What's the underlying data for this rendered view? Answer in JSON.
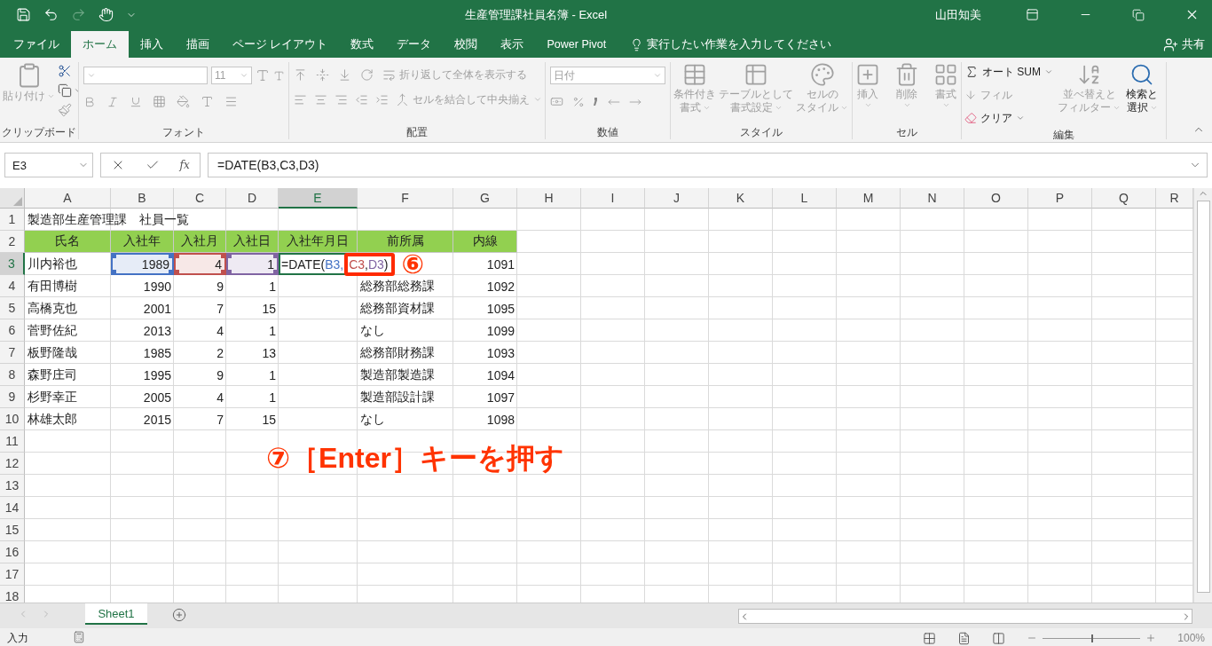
{
  "window": {
    "title": "生産管理課社員名簿  -  Excel",
    "user": "山田知美"
  },
  "tabs": [
    {
      "label": "ファイル",
      "selected": false
    },
    {
      "label": "ホーム",
      "selected": true
    },
    {
      "label": "挿入",
      "selected": false
    },
    {
      "label": "描画",
      "selected": false
    },
    {
      "label": "ページ レイアウト",
      "selected": false
    },
    {
      "label": "数式",
      "selected": false
    },
    {
      "label": "データ",
      "selected": false
    },
    {
      "label": "校閲",
      "selected": false
    },
    {
      "label": "表示",
      "selected": false
    },
    {
      "label": "Power Pivot",
      "selected": false
    }
  ],
  "tell_me": "実行したい作業を入力してください",
  "share": "共有",
  "ribbon": {
    "groups": [
      {
        "label": "クリップボード",
        "items": [
          {
            "lines": [
              "貼り付け"
            ],
            "disabled": true
          }
        ]
      },
      {
        "label": "フォント",
        "items": [
          {
            "value": "11",
            "disabled": true
          }
        ]
      },
      {
        "label": "配置",
        "items": [
          {
            "lines": [
              "折り返して全体を表示する"
            ],
            "disabled": true
          },
          {
            "lines": [
              "セルを結合して中央揃え"
            ],
            "disabled": true
          }
        ]
      },
      {
        "label": "数値",
        "items": [
          {
            "value": "日付",
            "disabled": true
          }
        ]
      },
      {
        "label": "スタイル",
        "items": [
          {
            "lines": [
              "条件付き",
              "書式"
            ],
            "disabled": true
          },
          {
            "lines": [
              "テーブルとして",
              "書式設定"
            ],
            "disabled": true
          },
          {
            "lines": [
              "セルの",
              "スタイル"
            ],
            "disabled": true
          }
        ]
      },
      {
        "label": "セル",
        "items": [
          {
            "lines": [
              "挿入"
            ],
            "disabled": true
          },
          {
            "lines": [
              "削除"
            ],
            "disabled": true
          },
          {
            "lines": [
              "書式"
            ],
            "disabled": true
          }
        ]
      },
      {
        "label": "編集",
        "items": [
          {
            "lines": [
              "オート SUM"
            ],
            "disabled": false
          },
          {
            "lines": [
              "フィル"
            ],
            "disabled": true
          },
          {
            "lines": [
              "クリア"
            ],
            "disabled": false
          },
          {
            "lines": [
              "並べ替えと",
              "フィルター"
            ],
            "disabled": true
          },
          {
            "lines": [
              "検索と",
              "選択"
            ],
            "disabled": false
          }
        ]
      }
    ]
  },
  "formula_bar": {
    "name_box": "E3",
    "function_label": "fx",
    "formula": "=DATE(B3,C3,D3)"
  },
  "columns": [
    {
      "label": "A",
      "selected": false
    },
    {
      "label": "B",
      "selected": false
    },
    {
      "label": "C",
      "selected": false
    },
    {
      "label": "D",
      "selected": false
    },
    {
      "label": "E",
      "selected": true
    },
    {
      "label": "F",
      "selected": false
    },
    {
      "label": "G",
      "selected": false
    },
    {
      "label": "H",
      "selected": false
    },
    {
      "label": "I",
      "selected": false
    },
    {
      "label": "J",
      "selected": false
    },
    {
      "label": "K",
      "selected": false
    },
    {
      "label": "L",
      "selected": false
    },
    {
      "label": "M",
      "selected": false
    },
    {
      "label": "N",
      "selected": false
    },
    {
      "label": "O",
      "selected": false
    },
    {
      "label": "P",
      "selected": false
    },
    {
      "label": "Q",
      "selected": false
    },
    {
      "label": "R",
      "selected": false
    }
  ],
  "rows": [
    {
      "number": "1",
      "kind": "title",
      "selected": false,
      "cells": [
        {
          "text": "製造部生産管理課　社員一覧"
        }
      ]
    },
    {
      "number": "2",
      "kind": "header",
      "selected": false,
      "cells": [
        {
          "text": "氏名"
        },
        {
          "text": "入社年"
        },
        {
          "text": "入社月"
        },
        {
          "text": "入社日"
        },
        {
          "text": "入社年月日"
        },
        {
          "text": "前所属"
        },
        {
          "text": "内線"
        }
      ]
    },
    {
      "number": "3",
      "kind": "data",
      "selected": true,
      "cells": [
        {
          "text": "川内裕也"
        },
        {
          "text": "1989",
          "color": "#4472c4"
        },
        {
          "text": "4",
          "color": "#c0504d"
        },
        {
          "text": "1",
          "color": "#8064a2"
        },
        {
          "kind": "formula",
          "parts": [
            {
              "text": "=DATE("
            },
            {
              "text": "B3,",
              "color": "#4472c4"
            },
            {
              "text": "C3",
              "color": "#c0504d"
            },
            {
              "text": ","
            },
            {
              "text": "D3",
              "color": "#8064a2"
            },
            {
              "text": ")"
            }
          ]
        },
        {},
        {
          "text": "1091"
        }
      ]
    },
    {
      "number": "4",
      "kind": "data",
      "selected": false,
      "cells": [
        {
          "text": "有田博樹"
        },
        {
          "text": "1990"
        },
        {
          "text": "9"
        },
        {
          "text": "1"
        },
        {},
        {
          "text": "総務部総務課"
        },
        {
          "text": "1092"
        }
      ]
    },
    {
      "number": "5",
      "kind": "data",
      "selected": false,
      "cells": [
        {
          "text": "高橋克也"
        },
        {
          "text": "2001"
        },
        {
          "text": "7"
        },
        {
          "text": "15"
        },
        {},
        {
          "text": "総務部資材課"
        },
        {
          "text": "1095"
        }
      ]
    },
    {
      "number": "6",
      "kind": "data",
      "selected": false,
      "cells": [
        {
          "text": "菅野佐紀"
        },
        {
          "text": "2013"
        },
        {
          "text": "4"
        },
        {
          "text": "1"
        },
        {},
        {
          "text": "なし"
        },
        {
          "text": "1099"
        }
      ]
    },
    {
      "number": "7",
      "kind": "data",
      "selected": false,
      "cells": [
        {
          "text": "板野隆哉"
        },
        {
          "text": "1985"
        },
        {
          "text": "2"
        },
        {
          "text": "13"
        },
        {},
        {
          "text": "総務部財務課"
        },
        {
          "text": "1093"
        }
      ]
    },
    {
      "number": "8",
      "kind": "data",
      "selected": false,
      "cells": [
        {
          "text": "森野庄司"
        },
        {
          "text": "1995"
        },
        {
          "text": "9"
        },
        {
          "text": "1"
        },
        {},
        {
          "text": "製造部製造課"
        },
        {
          "text": "1094"
        }
      ]
    },
    {
      "number": "9",
      "kind": "data",
      "selected": false,
      "cells": [
        {
          "text": "杉野幸正"
        },
        {
          "text": "2005"
        },
        {
          "text": "4"
        },
        {
          "text": "1"
        },
        {},
        {
          "text": "製造部設計課"
        },
        {
          "text": "1097"
        }
      ]
    },
    {
      "number": "10",
      "kind": "data",
      "selected": false,
      "cells": [
        {
          "text": "林雄太郎"
        },
        {
          "text": "2015"
        },
        {
          "text": "7"
        },
        {
          "text": "15"
        },
        {},
        {
          "text": "なし"
        },
        {
          "text": "1098"
        }
      ]
    },
    {
      "number": "11",
      "selected": false
    },
    {
      "number": "12",
      "selected": false
    },
    {
      "number": "13",
      "selected": false
    },
    {
      "number": "14",
      "selected": false
    },
    {
      "number": "15",
      "selected": false
    },
    {
      "number": "16",
      "selected": false
    },
    {
      "number": "17",
      "selected": false
    },
    {
      "number": "18",
      "selected": false
    }
  ],
  "annotations": [
    {
      "kind": "frame"
    },
    {
      "kind": "step",
      "text": "⑥"
    },
    {
      "kind": "instruction",
      "text": "⑦［Enter］キーを押す"
    }
  ],
  "sheet_tabs": [
    {
      "label": "Sheet1",
      "selected": true
    }
  ],
  "status_bar": {
    "mode": "入力",
    "zoom": "100%",
    "level": 0.5
  }
}
